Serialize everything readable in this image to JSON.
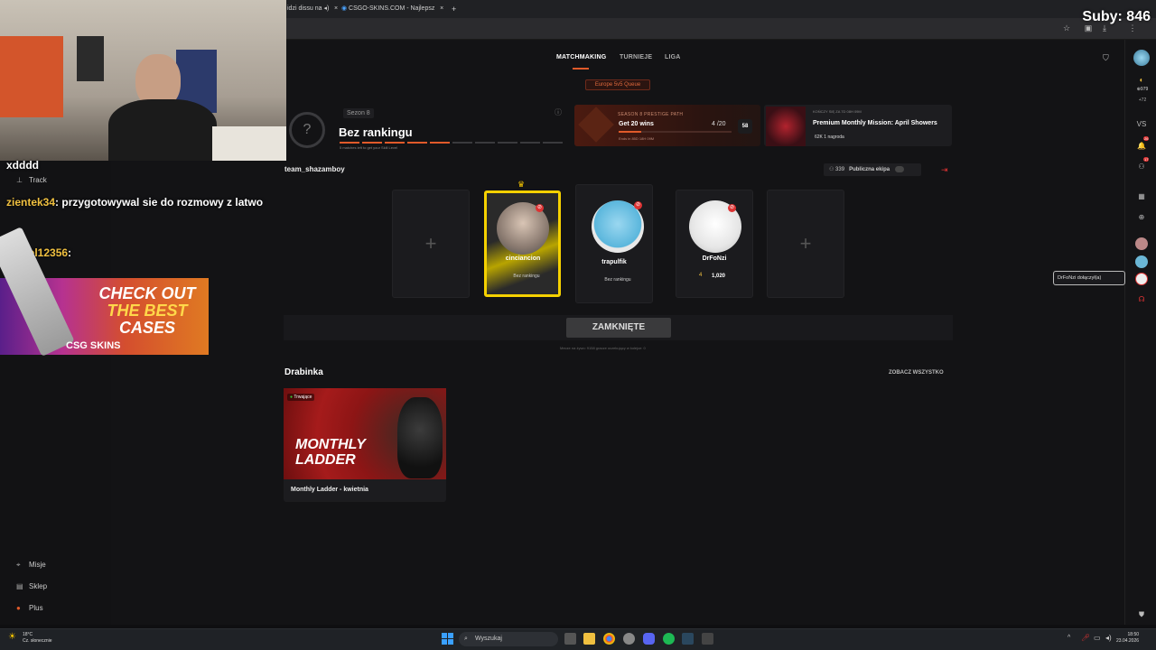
{
  "browser": {
    "tabs": [
      {
        "label": "idzi dissu na"
      },
      {
        "label": "CSGO-SKINS.COM - Najlepsz"
      }
    ]
  },
  "stream": {
    "subs": "Suby: 846",
    "chat": [
      {
        "user": "",
        "text": "xdddd"
      },
      {
        "user": "zientek34",
        "text": ": przygotowywal sie do rozmowy z latwo"
      },
      {
        "user": "daniel12356",
        "text": ":"
      }
    ],
    "ad": {
      "line1": "CHECK OUT",
      "line2": "THE BEST",
      "line3": "CASES",
      "brand": "CSG SKINS"
    }
  },
  "nav": {
    "matchmaking": "MATCHMAKING",
    "tournaments": "TURNIEJE",
    "league": "LIGA"
  },
  "queue": {
    "badge": "Europe 5v5 Queue"
  },
  "rank": {
    "season": "Sezon 8",
    "title": "Bez rankingu",
    "symbol": "?",
    "progress_matches_done": 0,
    "progress_matches_total": 5,
    "subtitle": "5 matches left to get your Skill Level"
  },
  "prestige": {
    "title": "SEASON 8 PRESTIGE PATH",
    "goal": "Get 20 wins",
    "progress": "4 /20",
    "progress_fraction": 0.2,
    "ends": "Ends in 85D 18H 09M",
    "badge": "58"
  },
  "mission": {
    "ends": "KOŃCZY SIĘ ZA 7D 08H 09M",
    "title": "Premium Monthly Mission: April Showers",
    "stats": "62K   1 nagroda"
  },
  "team": {
    "name": "team_shazamboy",
    "count": "339",
    "party_label": "Publiczna ekipa",
    "exit_icon": "exit-icon"
  },
  "players": [
    {
      "name": "cinciancion",
      "rank": "Bez rankingu",
      "leader": true
    },
    {
      "name": "trapulfik",
      "rank": "Bez rankingu",
      "leader": false
    },
    {
      "name": "DrFoNzi",
      "rank": "1,020",
      "level": "4",
      "leader": false
    }
  ],
  "lobby": {
    "closed_label": "ZAMKNIĘTE",
    "queue_info": "Mecze na żywo: 9158     gracze oczekujący w kolejce: 0"
  },
  "ladder": {
    "heading": "Drabinka",
    "see_all": "ZOBACZ WSZYSTKO",
    "live": "Trwające",
    "banner": "MONTHLY LADDER",
    "card_name": "Monthly Ladder - kwietnia"
  },
  "sidebar": {
    "track": "Track",
    "items": [
      {
        "label": "Misje"
      },
      {
        "label": "Sklep"
      },
      {
        "label": "Plus"
      }
    ]
  },
  "toast": {
    "text": "DrFoNzi dołączył(a)"
  },
  "right_bar": {
    "balance": "979",
    "plus": "+72",
    "notif": "26",
    "friends": "17"
  },
  "taskbar": {
    "weather_temp": "18°C",
    "weather_text": "Cz. słonecznie",
    "search": "Wyszukaj",
    "time": "18:50",
    "date": "23.04.2026"
  },
  "colors": {
    "accent": "#e05a2a",
    "leader_border": "#f5d100",
    "danger": "#d33333"
  }
}
